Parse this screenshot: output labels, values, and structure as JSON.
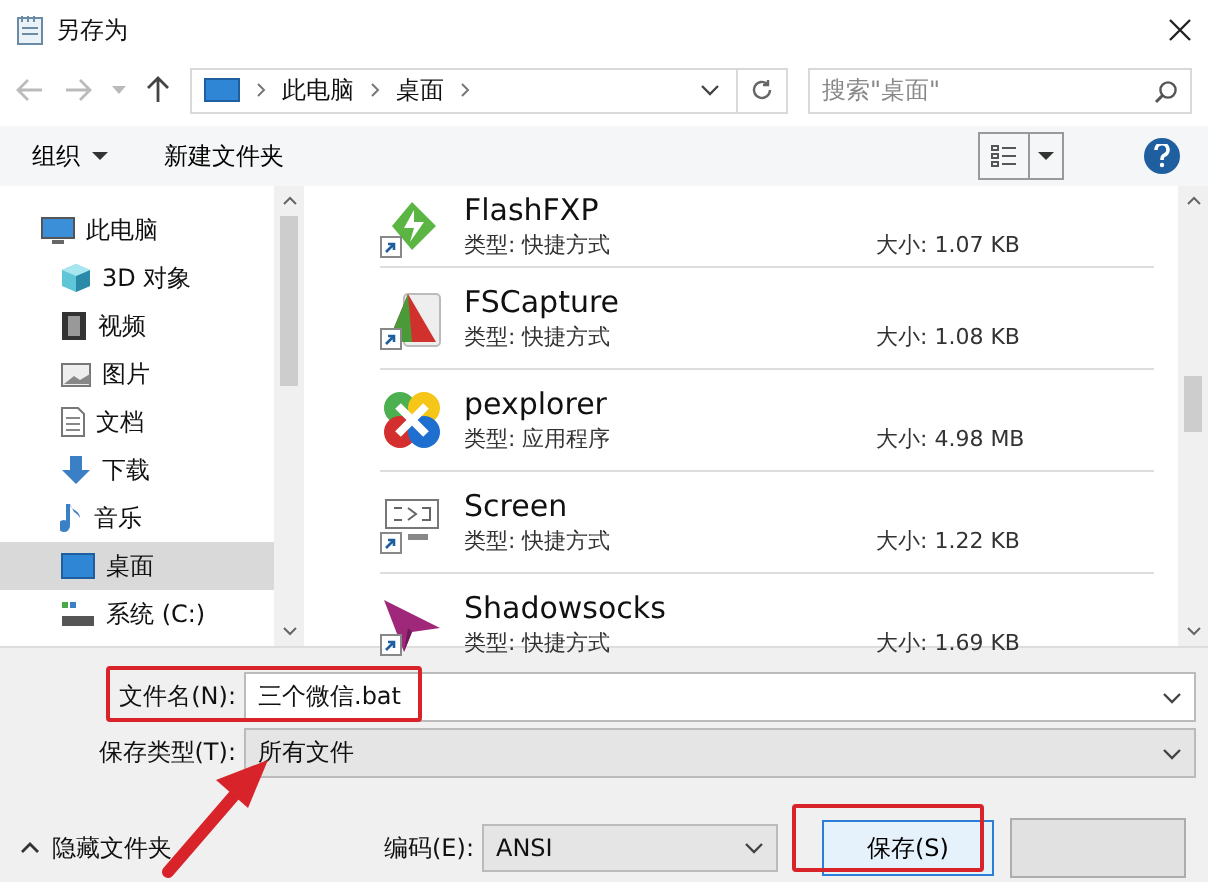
{
  "window": {
    "title": "另存为"
  },
  "address": {
    "path": [
      "此电脑",
      "桌面"
    ]
  },
  "search": {
    "placeholder": "搜索\"桌面\""
  },
  "toolbar": {
    "organize": "组织",
    "new_folder": "新建文件夹"
  },
  "sidebar": {
    "items": [
      {
        "label": "此电脑",
        "kind": "computer",
        "selected": false
      },
      {
        "label": "3D 对象",
        "kind": "cube",
        "selected": false
      },
      {
        "label": "视频",
        "kind": "film",
        "selected": false
      },
      {
        "label": "图片",
        "kind": "picture",
        "selected": false
      },
      {
        "label": "文档",
        "kind": "document",
        "selected": false
      },
      {
        "label": "下载",
        "kind": "download",
        "selected": false
      },
      {
        "label": "音乐",
        "kind": "music",
        "selected": false
      },
      {
        "label": "桌面",
        "kind": "desktop",
        "selected": true
      },
      {
        "label": "系统 (C:)",
        "kind": "drive",
        "selected": false
      }
    ]
  },
  "files": [
    {
      "name": "FlashFXP",
      "type": "类型: 快捷方式",
      "size": "大小: 1.07 KB",
      "kind": "flash",
      "shortcut": true
    },
    {
      "name": "FSCapture",
      "type": "类型: 快捷方式",
      "size": "大小: 1.08 KB",
      "kind": "capture",
      "shortcut": true
    },
    {
      "name": "pexplorer",
      "type": "类型: 应用程序",
      "size": "大小: 4.98 MB",
      "kind": "explorer",
      "shortcut": false
    },
    {
      "name": "Screen",
      "type": "类型: 快捷方式",
      "size": "大小: 1.22 KB",
      "kind": "screen",
      "shortcut": true
    },
    {
      "name": "Shadowsocks",
      "type": "类型: 快捷方式",
      "size": "大小: 1.69 KB",
      "kind": "plane",
      "shortcut": true
    }
  ],
  "form": {
    "filename_label": "文件名(N):",
    "filename": "三个微信.bat",
    "type_label": "保存类型(T):",
    "type": "所有文件",
    "hide_folders": "隐藏文件夹",
    "encoding_label": "编码(E):",
    "encoding": "ANSI",
    "save": "保存(S)"
  }
}
